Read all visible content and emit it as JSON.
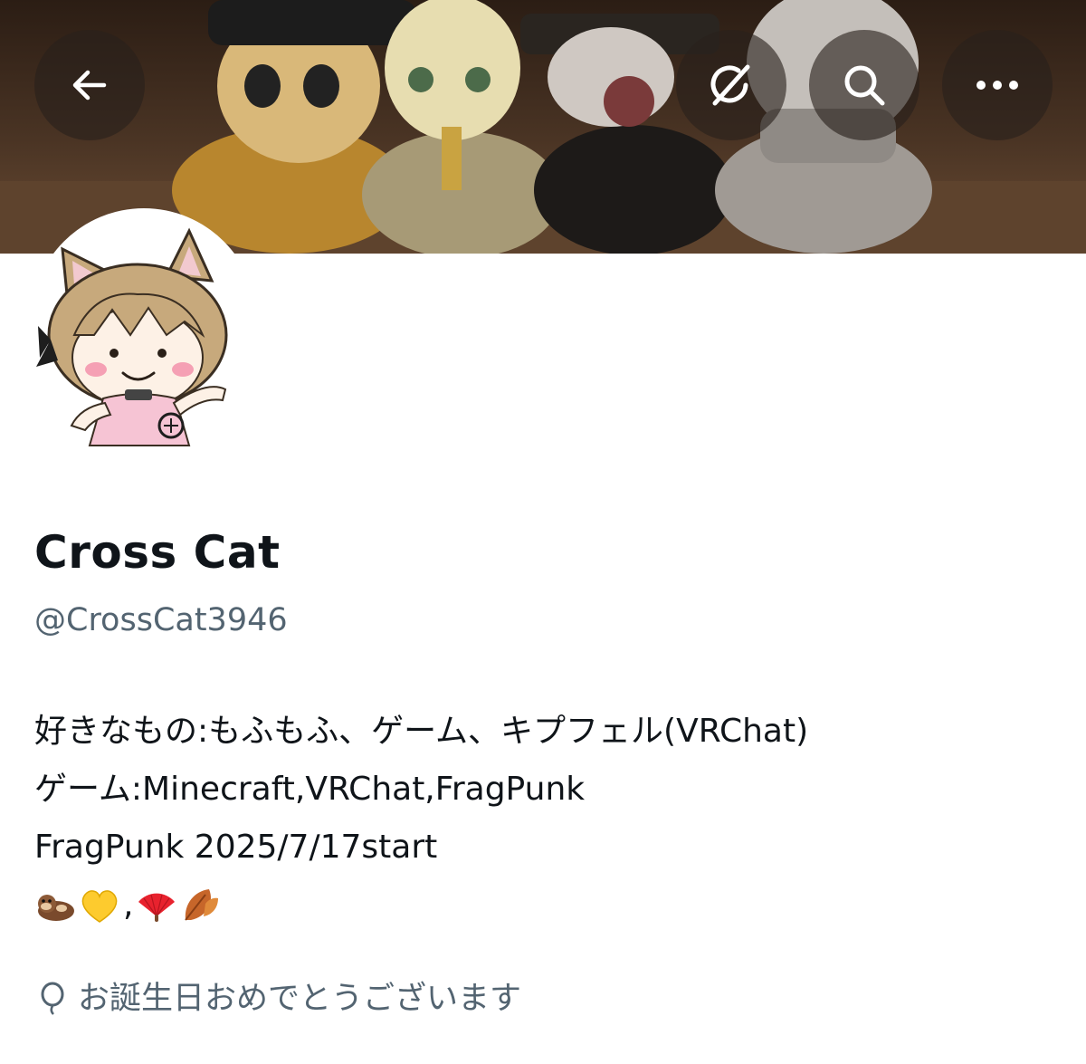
{
  "header": {
    "back_icon": "arrow-left-icon",
    "translate_icon": "grok-translate-icon",
    "search_icon": "search-icon",
    "more_icon": "more-horizontal-icon"
  },
  "profile": {
    "display_name": "Cross Cat",
    "handle": "@CrossCat3946",
    "bio_lines": [
      "好きなもの:もふもふ、ゲーム、キプフェル(VRChat)",
      "ゲーム:Minecraft,VRChat,FragPunk",
      "FragPunk 2025/7/17start"
    ],
    "bio_emoji": {
      "first": [
        "otter-emoji",
        "yellow-heart-emoji"
      ],
      "separator": ",",
      "second": [
        "folding-fan-emoji",
        "fallen-leaf-emoji"
      ]
    },
    "birthday_text": "お誕生日おめでとうございます",
    "birthday_icon": "balloon-icon"
  },
  "colors": {
    "primary_text": "#0f1419",
    "secondary_text": "#536471",
    "button_overlay": "rgba(40,32,28,0.62)"
  }
}
